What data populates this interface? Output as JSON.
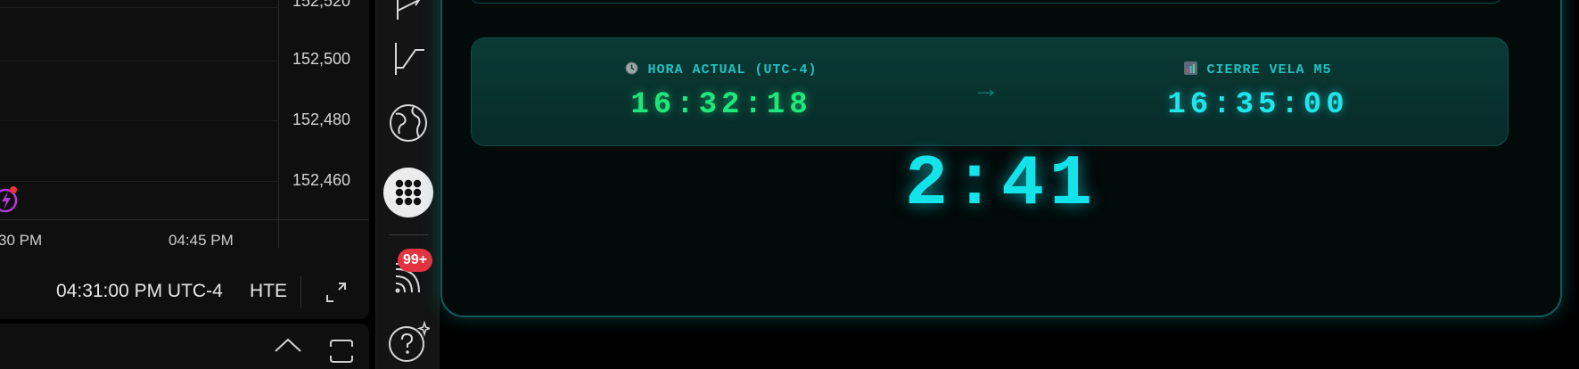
{
  "chart": {
    "price_labels": [
      "152,520",
      "152,500",
      "152,480",
      "152,460"
    ],
    "time_labels": [
      "30 PM",
      "04:45 PM"
    ],
    "status": {
      "clock": "04:31:00 PM UTC-4",
      "timezone": "HTE"
    }
  },
  "toolbar": {
    "tools": [
      "drawing-tool-icon",
      "trend-tool-icon",
      "globe-icon",
      "apps-grid-icon",
      "feed-icon",
      "help-icon"
    ],
    "notification_badge": "99+"
  },
  "timer": {
    "current_label": "HORA ACTUAL (UTC-4)",
    "current_time": "16:32:18",
    "close_label": "CIERRE VELA M5",
    "close_time": "16:35:00",
    "arrow": "→",
    "countdown": "2:41",
    "colors": {
      "current": "#1ee87b",
      "close": "#1fe6ea",
      "accent": "#1fc2c0",
      "frame": "#0f5d5b"
    }
  }
}
